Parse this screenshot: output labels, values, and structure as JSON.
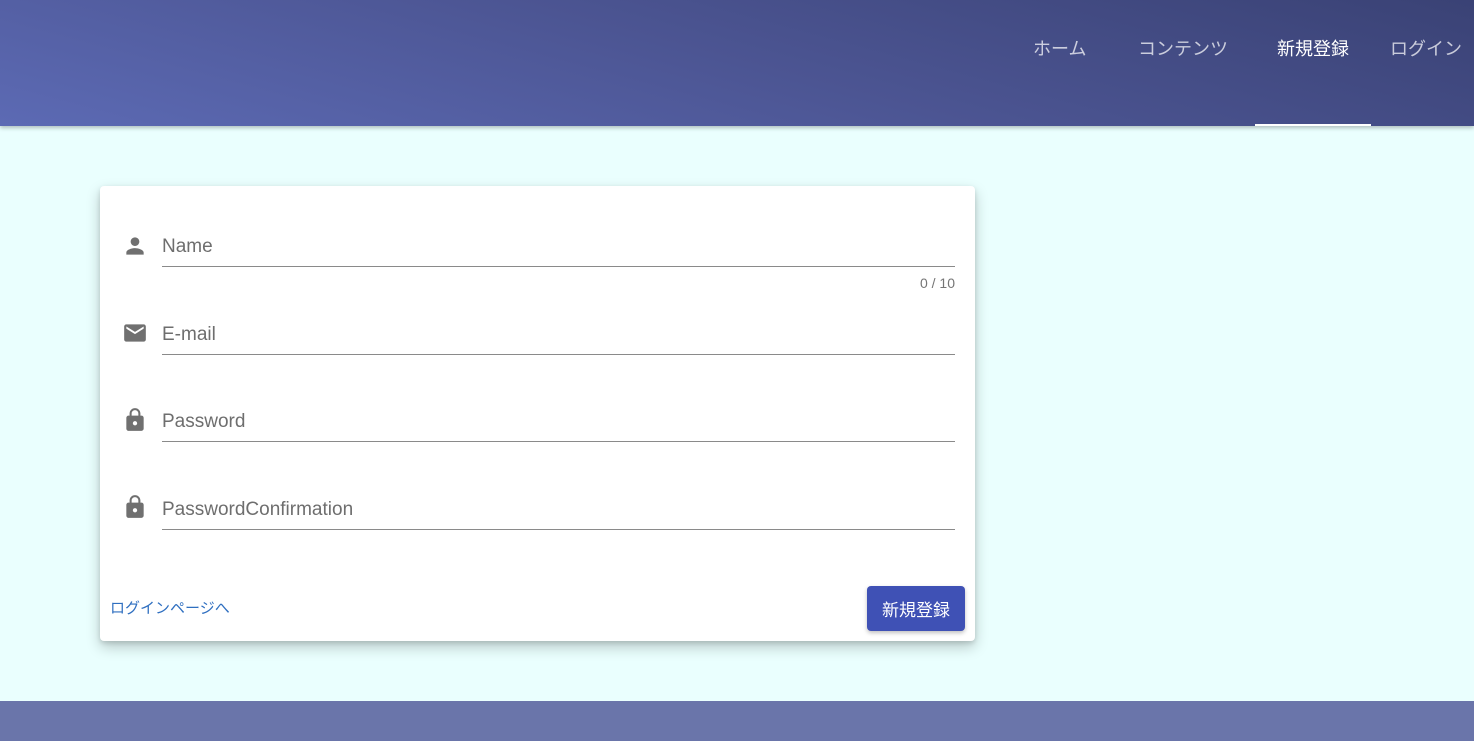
{
  "nav": {
    "items": [
      {
        "label": "ホーム",
        "active": false
      },
      {
        "label": "コンテンツ",
        "active": false
      },
      {
        "label": "新規登録",
        "active": true
      },
      {
        "label": "ログイン",
        "active": false
      }
    ]
  },
  "form": {
    "fields": [
      {
        "icon": "person-icon",
        "placeholder": "Name",
        "value": ""
      },
      {
        "icon": "mail-icon",
        "placeholder": "E-mail",
        "value": ""
      },
      {
        "icon": "lock-icon",
        "placeholder": "Password",
        "value": ""
      },
      {
        "icon": "lock-icon",
        "placeholder": "PasswordConfirmation",
        "value": ""
      }
    ],
    "name_counter": "0 / 10",
    "login_link": "ログインページへ",
    "submit_label": "新規登録"
  },
  "colors": {
    "primary": "#3f51b5",
    "background": "#eafffe",
    "link": "#2f6fc0"
  }
}
